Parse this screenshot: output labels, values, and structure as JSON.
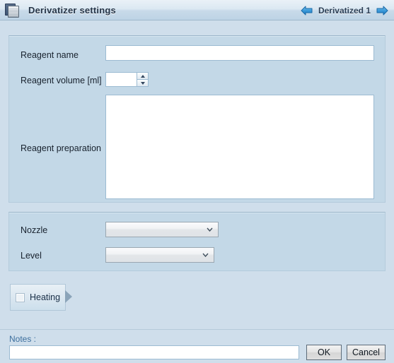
{
  "window": {
    "title": "Derivatizer settings",
    "icon": "derivatizer-icon"
  },
  "header_nav": {
    "prev_icon": "arrow-left-icon",
    "next_icon": "arrow-right-icon",
    "current_label": "Derivatized 1"
  },
  "reagent_panel": {
    "name_label": "Reagent name",
    "name_value": "",
    "volume_label": "Reagent volume [ml]",
    "volume_value": "",
    "preparation_label": "Reagent preparation",
    "preparation_value": ""
  },
  "nozzle_panel": {
    "nozzle_label": "Nozzle",
    "nozzle_value": "",
    "level_label": "Level",
    "level_value": ""
  },
  "heating": {
    "label": "Heating",
    "checked": false,
    "expander_icon": "triangle-right-icon"
  },
  "footer": {
    "notes_label": "Notes :",
    "notes_value": "",
    "ok_label": "OK",
    "cancel_label": "Cancel"
  },
  "colors": {
    "page_background": "#cfdeeb",
    "panel_background": "#c3d8e7",
    "accent_blue": "#3d6f9e",
    "arrow_blue": "#2f8fd6"
  }
}
